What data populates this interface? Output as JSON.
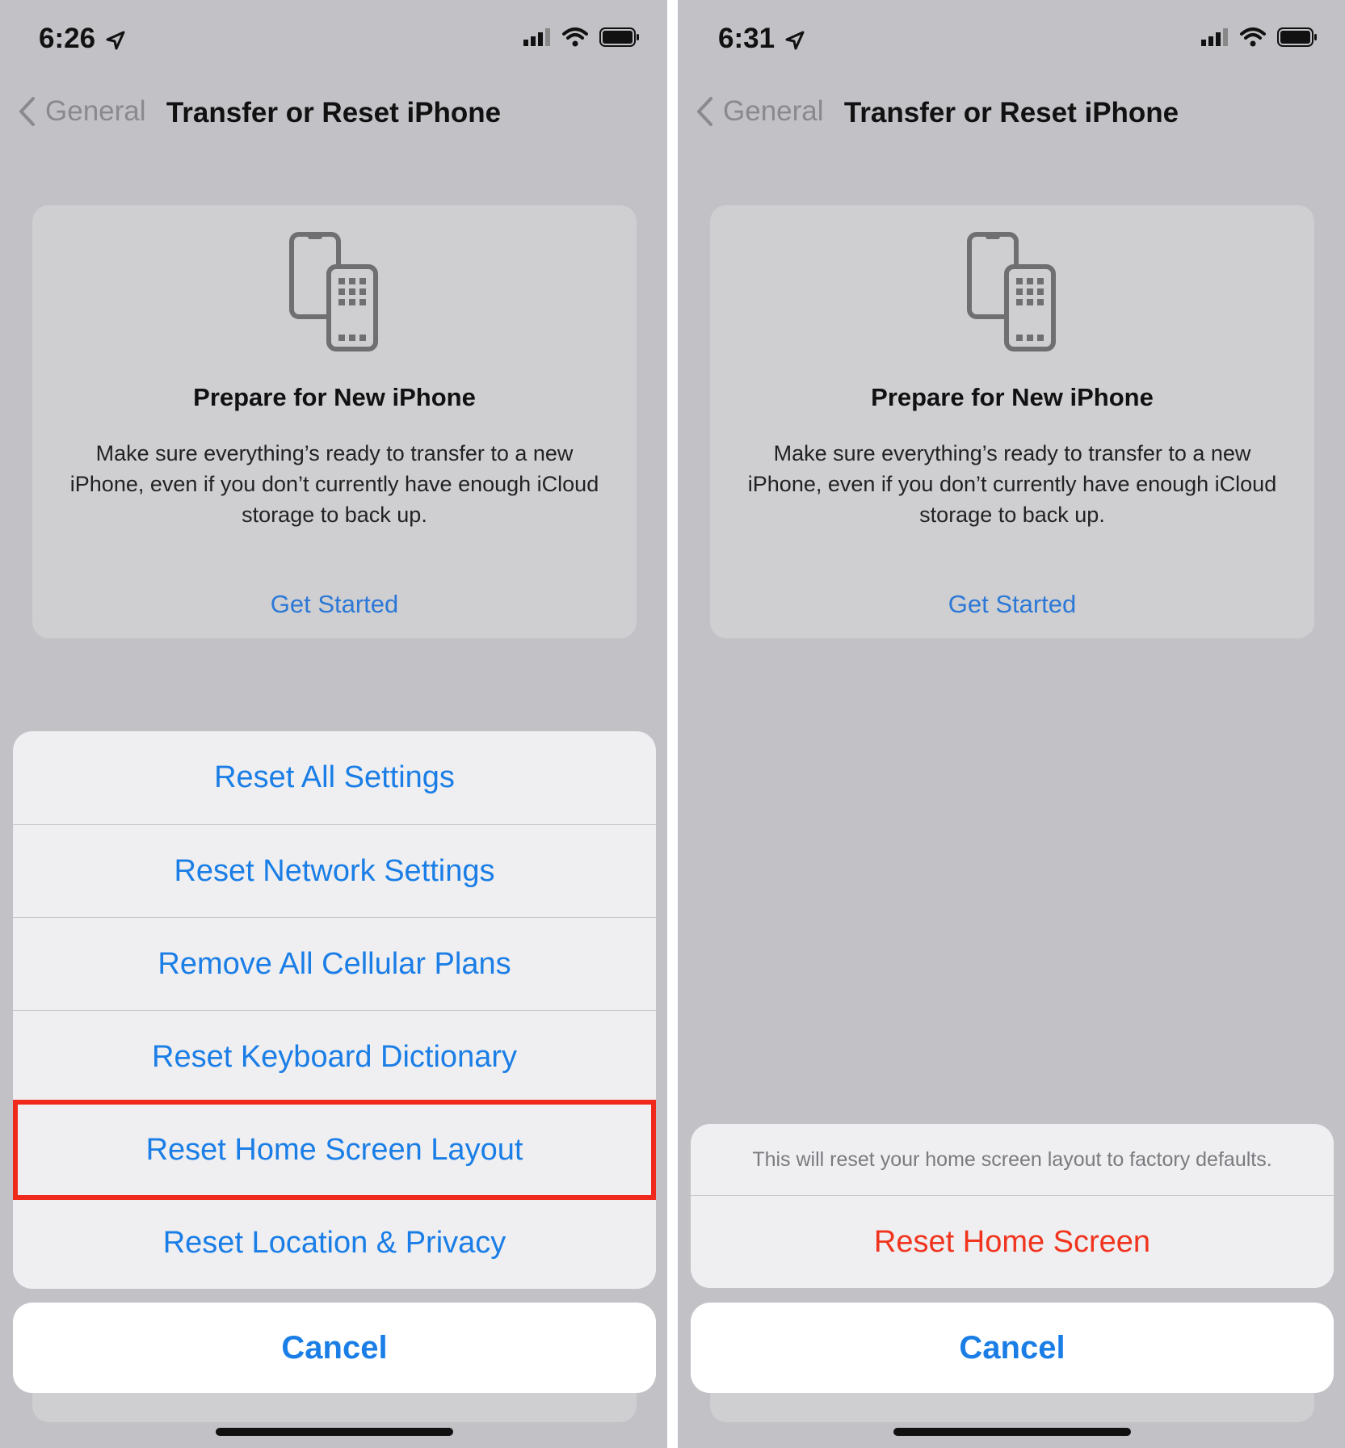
{
  "left": {
    "status": {
      "time": "6:26"
    },
    "nav": {
      "back_label": "General",
      "title": "Transfer or Reset iPhone"
    },
    "card": {
      "title": "Prepare for New iPhone",
      "description": "Make sure everything’s ready to transfer to a new iPhone, even if you don’t currently have enough iCloud storage to back up.",
      "link": "Get Started"
    },
    "action_sheet": {
      "items": [
        {
          "label": "Reset All Settings"
        },
        {
          "label": "Reset Network Settings"
        },
        {
          "label": "Remove All Cellular Plans"
        },
        {
          "label": "Reset Keyboard Dictionary"
        },
        {
          "label": "Reset Home Screen Layout",
          "highlighted": true
        },
        {
          "label": "Reset Location & Privacy"
        }
      ],
      "cancel": "Cancel"
    }
  },
  "right": {
    "status": {
      "time": "6:31"
    },
    "nav": {
      "back_label": "General",
      "title": "Transfer or Reset iPhone"
    },
    "card": {
      "title": "Prepare for New iPhone",
      "description": "Make sure everything’s ready to transfer to a new iPhone, even if you don’t currently have enough iCloud storage to back up.",
      "link": "Get Started"
    },
    "alert_sheet": {
      "message": "This will reset your home screen layout to factory defaults.",
      "action": "Reset Home Screen",
      "cancel": "Cancel"
    }
  },
  "colors": {
    "accent": "#1a7ee6",
    "destructive": "#f0341e",
    "highlight": "#ef2a1c",
    "background": "#c1c1c6"
  },
  "icons": [
    "location-arrow-icon",
    "cellular-signal-icon",
    "wifi-icon",
    "battery-icon",
    "chevron-left-icon",
    "transfer-phones-icon"
  ]
}
